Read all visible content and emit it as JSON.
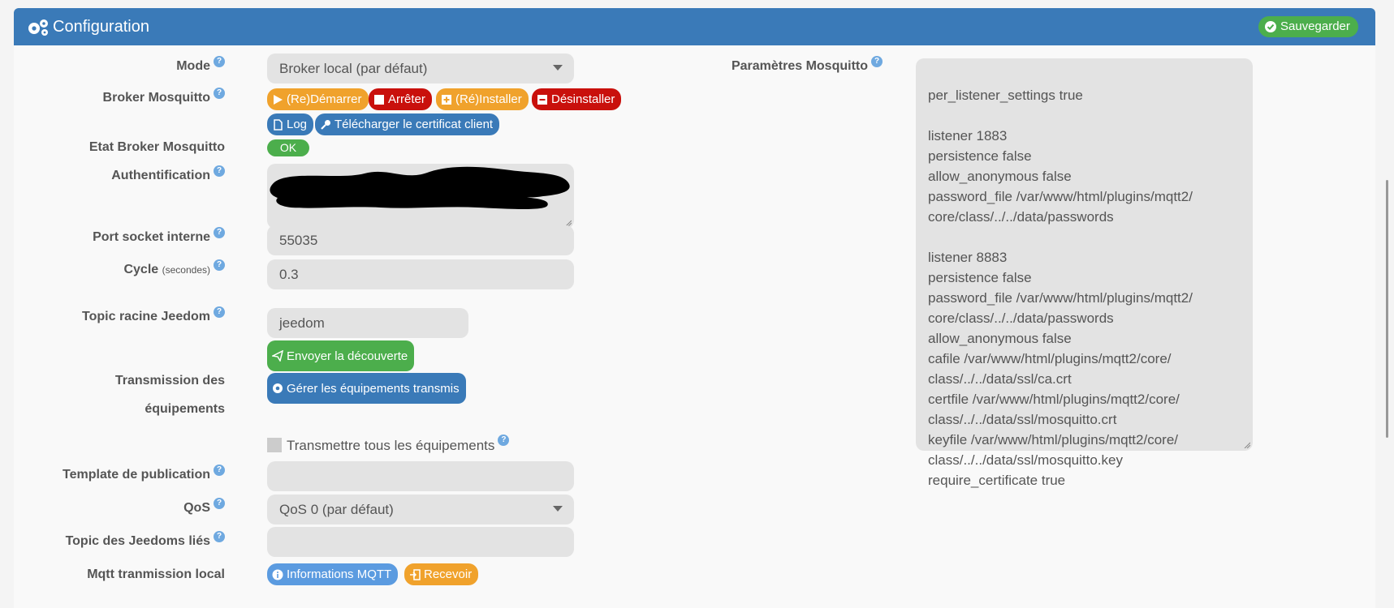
{
  "header": {
    "title": "Configuration",
    "save_label": "Sauvegarder"
  },
  "form": {
    "mode": {
      "label": "Mode",
      "value": "Broker local (par défaut)"
    },
    "broker": {
      "label": "Broker Mosquitto",
      "start": "(Re)Démarrer",
      "stop": "Arrêter",
      "install": "(Ré)Installer",
      "uninstall": "Désinstaller",
      "log": "Log",
      "download_cert": "Télécharger le certificat client"
    },
    "state": {
      "label": "Etat Broker Mosquitto",
      "value": "OK"
    },
    "auth": {
      "label": "Authentification"
    },
    "port": {
      "label": "Port socket interne",
      "value": "55035"
    },
    "cycle": {
      "label": "Cycle",
      "unit": "(secondes)",
      "value": "0.3"
    },
    "topic_root": {
      "label": "Topic racine Jeedom",
      "value": "jeedom"
    },
    "transmission": {
      "label_line1": "Transmission des",
      "label_line2": "équipements",
      "send_discovery": "Envoyer la découverte",
      "manage": "Gérer les équipements transmis",
      "transmit_all": "Transmettre tous les équipements"
    },
    "template": {
      "label": "Template de publication",
      "value": ""
    },
    "qos": {
      "label": "QoS",
      "value": "QoS 0 (par défaut)"
    },
    "linked_topics": {
      "label": "Topic des Jeedoms liés",
      "value": ""
    },
    "mqtt_local": {
      "label": "Mqtt tranmission local",
      "info": "Informations MQTT",
      "receive": "Recevoir"
    }
  },
  "mosquitto_params": {
    "label": "Paramètres Mosquitto",
    "value": "per_listener_settings true\n\nlistener 1883\npersistence false\nallow_anonymous false\npassword_file /var/www/html/plugins/mqtt2/\ncore/class/../../data/passwords\n\nlistener 8883\npersistence false\npassword_file /var/www/html/plugins/mqtt2/\ncore/class/../../data/passwords\nallow_anonymous false\ncafile /var/www/html/plugins/mqtt2/core/\nclass/../../data/ssl/ca.crt\ncertfile /var/www/html/plugins/mqtt2/core/\nclass/../../data/ssl/mosquitto.crt\nkeyfile /var/www/html/plugins/mqtt2/core/\nclass/../../data/ssl/mosquitto.key\nrequire_certificate true"
  },
  "help_glyph": "?",
  "colors": {
    "header": "#3a7ab8",
    "success": "#4cae4c",
    "warning": "#f0a22c",
    "danger": "#c9100c",
    "info": "#6fa9e0"
  }
}
